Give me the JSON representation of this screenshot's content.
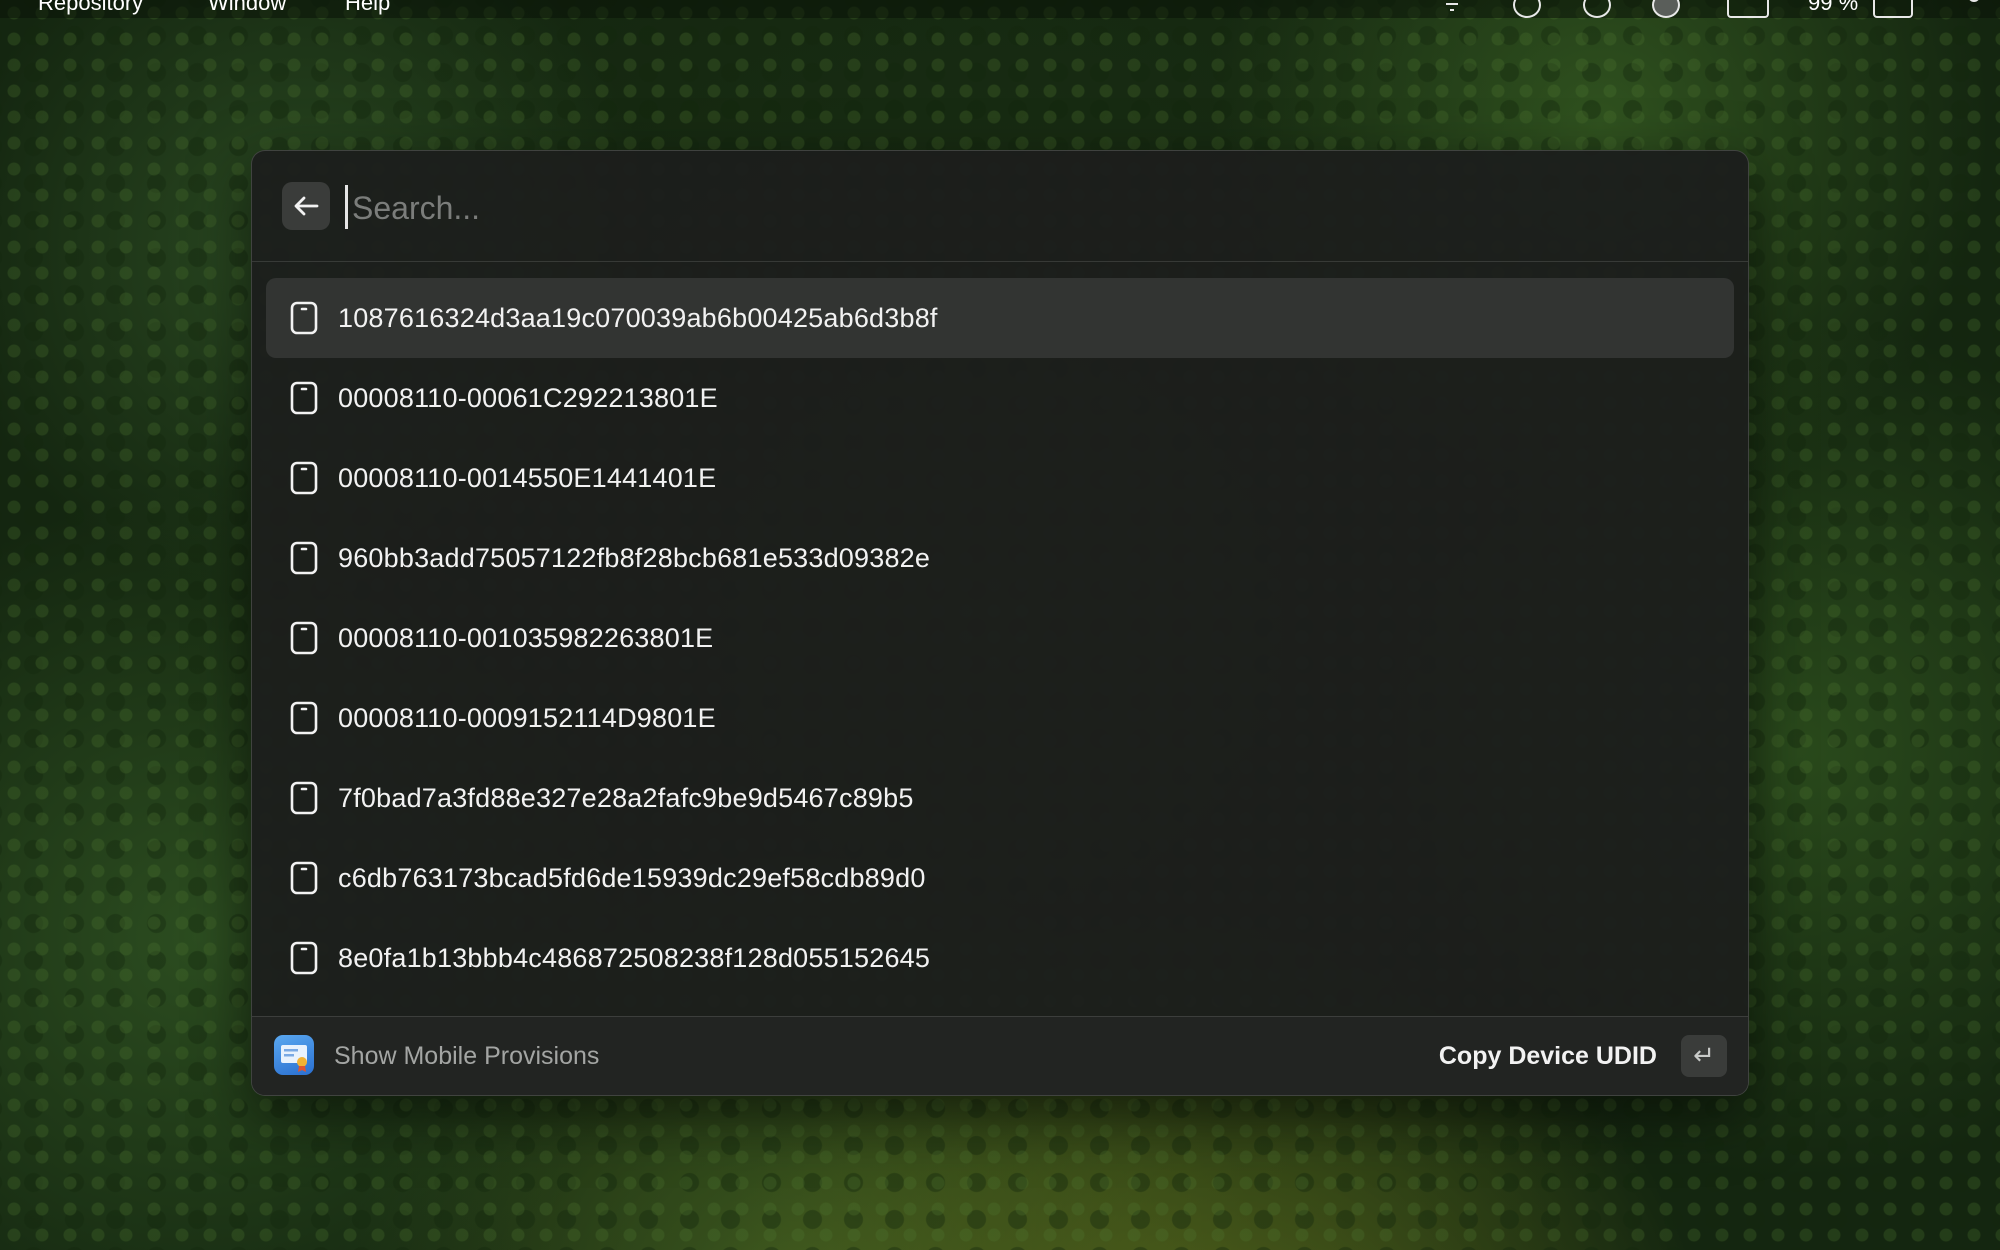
{
  "menubar": {
    "items": [
      "Repository",
      "Window",
      "Help"
    ],
    "battery_text": "99 %"
  },
  "search": {
    "placeholder": "Search...",
    "value": ""
  },
  "back_button": {
    "icon": "arrow-left-icon"
  },
  "devices": [
    {
      "udid": "1087616324d3aa19c070039ab6b00425ab6d3b8f",
      "selected": true
    },
    {
      "udid": "00008110-00061C292213801E",
      "selected": false
    },
    {
      "udid": "00008110-0014550E1441401E",
      "selected": false
    },
    {
      "udid": "960bb3add75057122fb8f28bcb681e533d09382e",
      "selected": false
    },
    {
      "udid": "00008110-001035982263801E",
      "selected": false
    },
    {
      "udid": "00008110-0009152114D9801E",
      "selected": false
    },
    {
      "udid": "7f0bad7a3fd88e327e28a2fafc9be9d5467c89b5",
      "selected": false
    },
    {
      "udid": "c6db763173bcad5fd6de15939dc29ef58cdb89d0",
      "selected": false
    },
    {
      "udid": "8e0fa1b13bbb4c486872508238f128d055152645",
      "selected": false
    }
  ],
  "footer": {
    "left_label": "Show Mobile Provisions",
    "action_label": "Copy Device UDID",
    "action_key": "↵"
  },
  "colors": {
    "panel_bg": "#1c1e1c",
    "selected_row": "#323432",
    "text": "#f2f2f2",
    "muted_text": "#a3a5a3"
  }
}
